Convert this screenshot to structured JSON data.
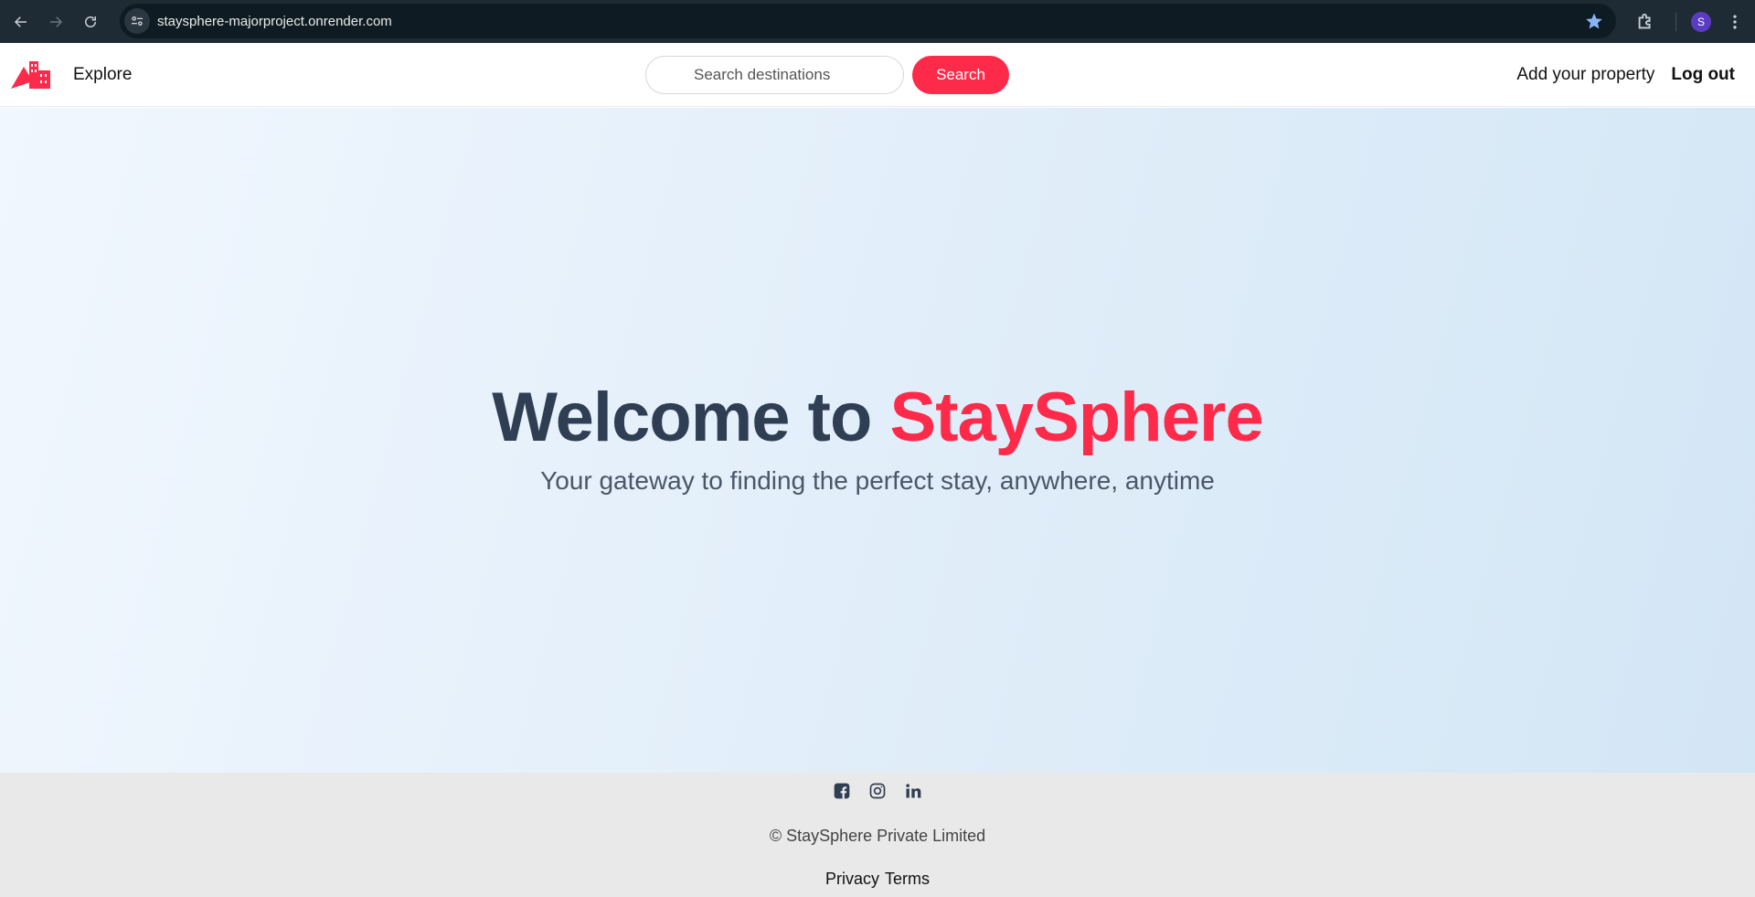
{
  "browser": {
    "url": "staysphere-majorproject.onrender.com",
    "profile_initial": "S",
    "accent": "#8ab4f8"
  },
  "navbar": {
    "explore_label": "Explore",
    "search_placeholder": "Search destinations",
    "search_button_label": "Search",
    "add_property_label": "Add your property",
    "logout_label": "Log out",
    "brand_color": "#fe2a4a"
  },
  "hero": {
    "title_prefix": "Welcome to ",
    "title_brand": "StaySphere",
    "subtitle": "Your gateway to finding the perfect stay, anywhere, anytime"
  },
  "footer": {
    "social_icons": [
      "facebook-icon",
      "instagram-icon",
      "linkedin-icon"
    ],
    "copyright": "© StaySphere Private Limited",
    "privacy_label": "Privacy",
    "terms_label": "Terms"
  }
}
